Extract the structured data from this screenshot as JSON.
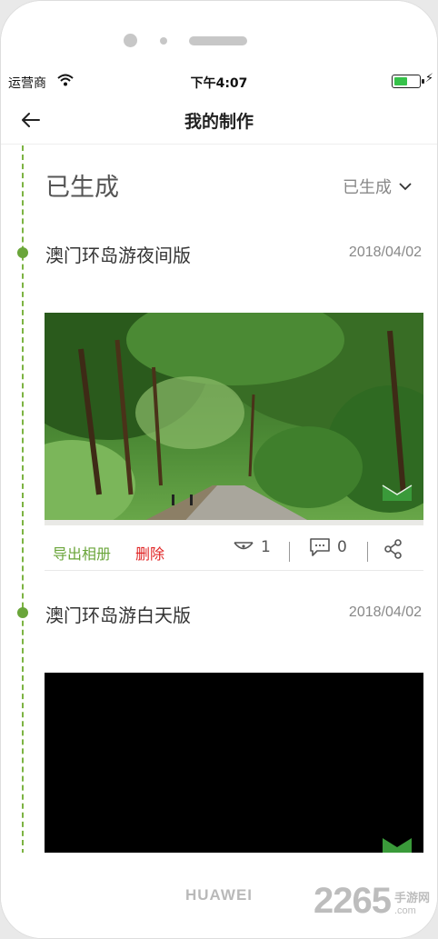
{
  "status": {
    "carrier": "运营商",
    "time": "下午4:07",
    "battery_level": 0.55
  },
  "nav": {
    "title": "我的制作",
    "back_icon": "arrow-left-icon"
  },
  "section": {
    "title": "已生成",
    "filter_label": "已生成"
  },
  "items": [
    {
      "title": "澳门环岛游夜间版",
      "date": "2018/04/02",
      "export_label": "导出相册",
      "delete_label": "删除",
      "likes": "1",
      "comments": "0"
    },
    {
      "title": "澳门环岛游白天版",
      "date": "2018/04/02"
    }
  ],
  "device": {
    "brand": "HUAWEI"
  },
  "watermark": {
    "number": "2265",
    "cn": "手游网",
    "suffix": ".com"
  },
  "colors": {
    "accent_green": "#6aa53a",
    "delete_red": "#e02424"
  }
}
